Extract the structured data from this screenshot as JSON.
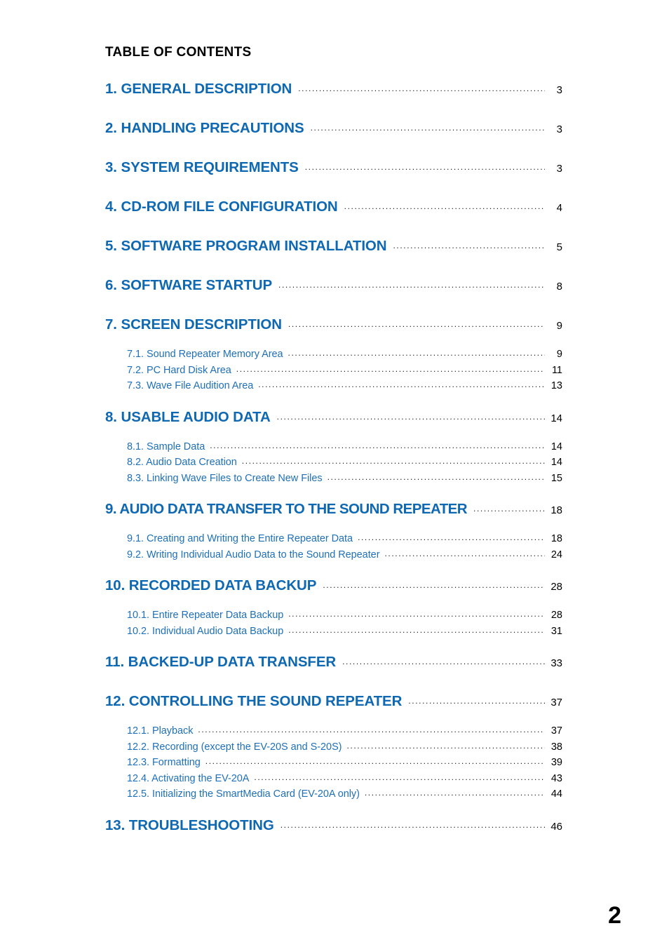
{
  "document": {
    "title": "TABLE OF CONTENTS",
    "page_number": "2",
    "colors": {
      "heading_blue": "#0f68b2",
      "subentry_blue": "#1f70b8",
      "text_black": "#000000"
    }
  },
  "entries": [
    {
      "level": "major",
      "label": "1. GENERAL DESCRIPTION",
      "page": "3"
    },
    {
      "level": "major",
      "label": "2. HANDLING PRECAUTIONS",
      "page": "3"
    },
    {
      "level": "major",
      "label": "3. SYSTEM REQUIREMENTS",
      "page": "3"
    },
    {
      "level": "major",
      "label": "4. CD-ROM FILE CONFIGURATION",
      "page": "4"
    },
    {
      "level": "major",
      "label": "5. SOFTWARE PROGRAM INSTALLATION",
      "page": "5"
    },
    {
      "level": "major",
      "label": "6. SOFTWARE STARTUP",
      "page": "8"
    },
    {
      "level": "major",
      "label": "7. SCREEN DESCRIPTION",
      "page": "9"
    },
    {
      "level": "sub",
      "label": "7.1. Sound Repeater Memory Area",
      "page": "9"
    },
    {
      "level": "sub",
      "label": "7.2. PC Hard Disk Area",
      "page": "11"
    },
    {
      "level": "sub",
      "label": "7.3. Wave File Audition Area",
      "page": "13"
    },
    {
      "level": "major",
      "label": "8. USABLE AUDIO DATA",
      "page": "14"
    },
    {
      "level": "sub",
      "label": "8.1. Sample Data",
      "page": "14"
    },
    {
      "level": "sub",
      "label": "8.2. Audio Data Creation",
      "page": "14"
    },
    {
      "level": "sub",
      "label": "8.3. Linking Wave Files to Create New Files",
      "page": "15"
    },
    {
      "level": "major",
      "label": "9. AUDIO DATA TRANSFER TO THE SOUND REPEATER",
      "page": "18"
    },
    {
      "level": "sub",
      "label": "9.1. Creating and Writing the Entire Repeater Data",
      "page": "18"
    },
    {
      "level": "sub",
      "label": "9.2. Writing Individual Audio Data to the Sound Repeater",
      "page": "24"
    },
    {
      "level": "major",
      "label": "10. RECORDED DATA BACKUP",
      "page": "28"
    },
    {
      "level": "sub",
      "label": "10.1. Entire Repeater Data Backup",
      "page": "28"
    },
    {
      "level": "sub",
      "label": "10.2. Individual Audio Data Backup",
      "page": "31"
    },
    {
      "level": "major",
      "label": "11. BACKED-UP DATA TRANSFER",
      "page": "33"
    },
    {
      "level": "major",
      "label": "12. CONTROLLING THE SOUND REPEATER",
      "page": "37"
    },
    {
      "level": "sub",
      "label": "12.1. Playback",
      "page": "37"
    },
    {
      "level": "sub",
      "label": "12.2. Recording (except the EV-20S and S-20S)",
      "page": "38"
    },
    {
      "level": "sub",
      "label": "12.3. Formatting",
      "page": "39"
    },
    {
      "level": "sub",
      "label": "12.4. Activating the EV-20A",
      "page": "43"
    },
    {
      "level": "sub",
      "label": "12.5. Initializing the SmartMedia Card (EV-20A only)",
      "page": "44"
    },
    {
      "level": "major",
      "label": "13. TROUBLESHOOTING",
      "page": "46"
    }
  ]
}
